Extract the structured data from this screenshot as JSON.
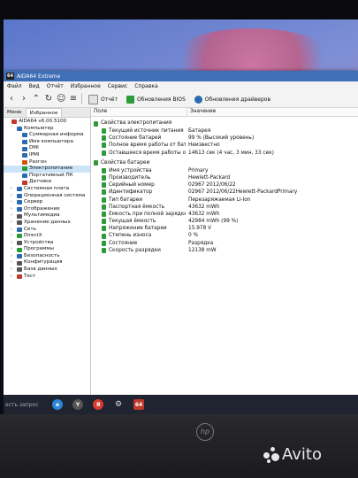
{
  "window": {
    "title": "AIDA64 Extreme",
    "app_icon": "64"
  },
  "menu": [
    "Файл",
    "Вид",
    "Отчёт",
    "Избранное",
    "Сервис",
    "Справка"
  ],
  "toolbar": {
    "report": "Отчёт",
    "bios": "Обновления BIOS",
    "drivers": "Обновления драйверов"
  },
  "left_tabs": [
    "Меню",
    "Избранное"
  ],
  "tree": [
    {
      "label": "AIDA64 v6.00.5100",
      "indent": 0,
      "color": "#c0392b",
      "caret": ""
    },
    {
      "label": "Компьютер",
      "indent": 1,
      "color": "#2b6cb0",
      "caret": "v"
    },
    {
      "label": "Суммарная информа",
      "indent": 2,
      "color": "#2b6cb0",
      "caret": ""
    },
    {
      "label": "Имя компьютера",
      "indent": 2,
      "color": "#2b6cb0",
      "caret": ""
    },
    {
      "label": "DMI",
      "indent": 2,
      "color": "#2b6cb0",
      "caret": ""
    },
    {
      "label": "IPMI",
      "indent": 2,
      "color": "#2b6cb0",
      "caret": ""
    },
    {
      "label": "Разгон",
      "indent": 2,
      "color": "#d35400",
      "caret": ""
    },
    {
      "label": "Электропитание",
      "indent": 2,
      "color": "#2e9b3a",
      "caret": "",
      "selected": true
    },
    {
      "label": "Портативный ПК",
      "indent": 2,
      "color": "#2b6cb0",
      "caret": ""
    },
    {
      "label": "Датчики",
      "indent": 2,
      "color": "#c0392b",
      "caret": ""
    },
    {
      "label": "Системная плата",
      "indent": 1,
      "color": "#2b6cb0",
      "caret": ">"
    },
    {
      "label": "Операционная система",
      "indent": 1,
      "color": "#2b6cb0",
      "caret": ">"
    },
    {
      "label": "Сервер",
      "indent": 1,
      "color": "#2b6cb0",
      "caret": ">"
    },
    {
      "label": "Отображение",
      "indent": 1,
      "color": "#2b6cb0",
      "caret": ">"
    },
    {
      "label": "Мультимедиа",
      "indent": 1,
      "color": "#555",
      "caret": ">"
    },
    {
      "label": "Хранение данных",
      "indent": 1,
      "color": "#555",
      "caret": ">"
    },
    {
      "label": "Сеть",
      "indent": 1,
      "color": "#2b6cb0",
      "caret": ">"
    },
    {
      "label": "DirectX",
      "indent": 1,
      "color": "#2e9b3a",
      "caret": ">"
    },
    {
      "label": "Устройства",
      "indent": 1,
      "color": "#555",
      "caret": ">"
    },
    {
      "label": "Программы",
      "indent": 1,
      "color": "#2e9b3a",
      "caret": ">"
    },
    {
      "label": "Безопасность",
      "indent": 1,
      "color": "#2b6cb0",
      "caret": ">"
    },
    {
      "label": "Конфигурация",
      "indent": 1,
      "color": "#555",
      "caret": ">"
    },
    {
      "label": "База данных",
      "indent": 1,
      "color": "#555",
      "caret": ">"
    },
    {
      "label": "Тест",
      "indent": 1,
      "color": "#c0392b",
      "caret": ">"
    }
  ],
  "columns": {
    "field": "Поле",
    "value": "Значение"
  },
  "sections": [
    {
      "title": "Свойства электропитания",
      "rows": [
        {
          "k": "Текущий источник питания",
          "v": "Батарея"
        },
        {
          "k": "Состояние батарей",
          "v": "99 % (Высокий уровень)"
        },
        {
          "k": "Полное время работы от бата...",
          "v": "Неизвестно"
        },
        {
          "k": "Оставшееся время работы от ...",
          "v": "14613 сек (4 час, 3 мин, 33 сек)"
        }
      ]
    },
    {
      "title": "Свойства батареи",
      "rows": [
        {
          "k": "Имя устройства",
          "v": "Primary"
        },
        {
          "k": "Производитель",
          "v": "Hewlett-Packard"
        },
        {
          "k": "Серийный номер",
          "v": "02967 2012/06/22"
        },
        {
          "k": "Идентификатор",
          "v": "02967 2012/06/22Hewlett-PackardPrimary"
        },
        {
          "k": "Тип батареи",
          "v": "Перезаряжаемая Li-Ion"
        },
        {
          "k": "Паспортная ёмкость",
          "v": "43632 mWh"
        },
        {
          "k": "Ёмкость при полной зарядке",
          "v": "43632 mWh"
        },
        {
          "k": "Текущая ёмкость",
          "v": "42984 mWh  (99 %)"
        },
        {
          "k": "Напряжение батареи",
          "v": "15.978 V"
        },
        {
          "k": "Степень износа",
          "v": "0 %"
        },
        {
          "k": "Состояние",
          "v": "Разрядка"
        },
        {
          "k": "Скорость разрядки",
          "v": "12138 mW"
        }
      ]
    }
  ],
  "taskbar": {
    "search": "есть запрос",
    "aida_label": "64"
  },
  "watermark": {
    "brand": "hp",
    "avito": "Avito"
  }
}
